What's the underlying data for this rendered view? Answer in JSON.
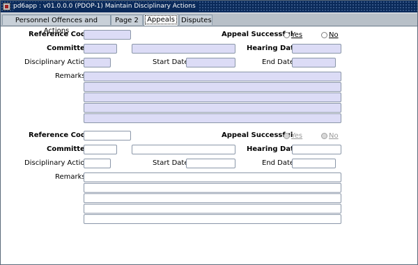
{
  "window": {
    "title": "pd6app : v01.0.0.0 (PDOP-1) Maintain Disciplinary Actions"
  },
  "tabs": [
    {
      "label": "Personnel Offences and Actions",
      "active": false
    },
    {
      "label": "Page 2",
      "active": false
    },
    {
      "label": "Appeals",
      "active": true
    },
    {
      "label": "Disputes",
      "active": false
    }
  ],
  "labels": {
    "reference_code": "Reference Code",
    "appeal_successful": "Appeal Successful",
    "yes": "Yes",
    "no": "No",
    "committee": "Committee",
    "hearing_date": "Hearing Date",
    "disciplinary_action": "Disciplinary Action",
    "start_date": "Start Date",
    "end_date": "End Date",
    "remarks": "Remarks"
  },
  "records": [
    {
      "reference_code": "",
      "committee_code": "",
      "committee_name": "",
      "hearing_date": "",
      "disciplinary_action": "",
      "start_date": "",
      "end_date": "",
      "remarks": [
        "",
        "",
        "",
        "",
        ""
      ],
      "appeal_successful": ""
    },
    {
      "reference_code": "",
      "committee_code": "",
      "committee_name": "",
      "hearing_date": "",
      "disciplinary_action": "",
      "start_date": "",
      "end_date": "",
      "remarks": [
        "",
        "",
        "",
        "",
        ""
      ],
      "appeal_successful": ""
    }
  ],
  "colors": {
    "title_bg": "#0a2a5a",
    "active_field": "#dcdcf6",
    "inactive_field": "#ffffff",
    "tab_bar": "#b8c0c8"
  }
}
